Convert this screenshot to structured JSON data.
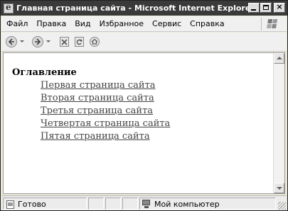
{
  "window": {
    "title": "Главная страница сайта - Microsoft Internet Explorer"
  },
  "menubar": {
    "items": [
      "Файл",
      "Правка",
      "Вид",
      "Избранное",
      "Сервис",
      "Справка"
    ]
  },
  "page": {
    "heading": "Оглавление",
    "links": [
      "Первая страница сайта",
      "Вторая страница сайта",
      "Третья страница сайта",
      "Четвертая страница сайта",
      "Пятая страница сайта"
    ]
  },
  "statusbar": {
    "status": "Готово",
    "zone": "Мой компьютер"
  },
  "icons": {
    "app": "ie-icon",
    "back": "back-arrow-icon",
    "forward": "forward-arrow-icon",
    "stop": "stop-icon",
    "refresh": "refresh-icon",
    "home": "home-icon",
    "status_page": "page-icon",
    "zone": "computer-icon"
  }
}
